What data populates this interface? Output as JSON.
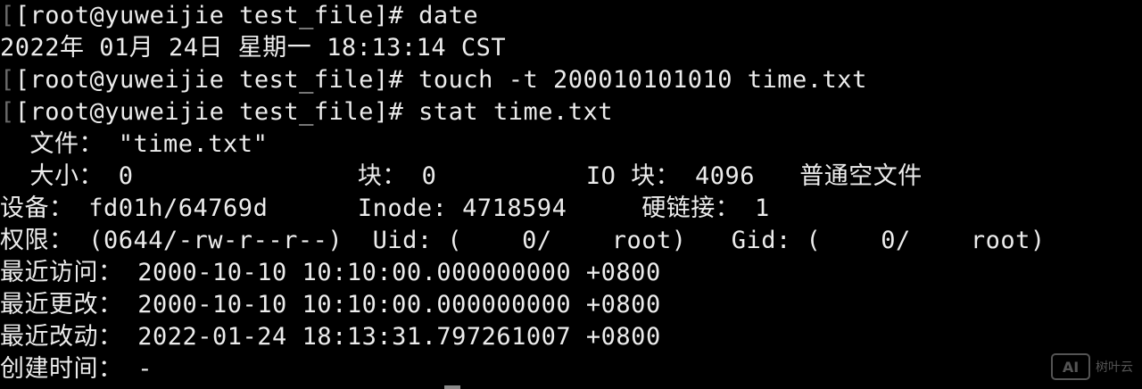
{
  "terminal": {
    "lines": [
      "[root@yuweijie test_file]# date",
      "2022年 01月 24日 星期一 18:13:14 CST",
      "[root@yuweijie test_file]# touch -t 200010101010 time.txt",
      "[root@yuweijie test_file]# stat time.txt",
      "  文件： \"time.txt\"",
      "  大小： 0               块： 0          IO 块： 4096   普通空文件",
      "设备： fd01h/64769d      Inode: 4718594     硬链接： 1",
      "权限： (0644/-rw-r--r--)  Uid: (    0/    root)   Gid: (    0/    root)",
      "最近访问： 2000-10-10 10:10:00.000000000 +0800",
      "最近更改： 2000-10-10 10:10:00.000000000 +0800",
      "最近改动： 2022-01-24 18:13:31.797261007 +0800",
      "创建时间： -"
    ]
  },
  "watermark": {
    "logo": "AI",
    "text": "树叶云"
  }
}
